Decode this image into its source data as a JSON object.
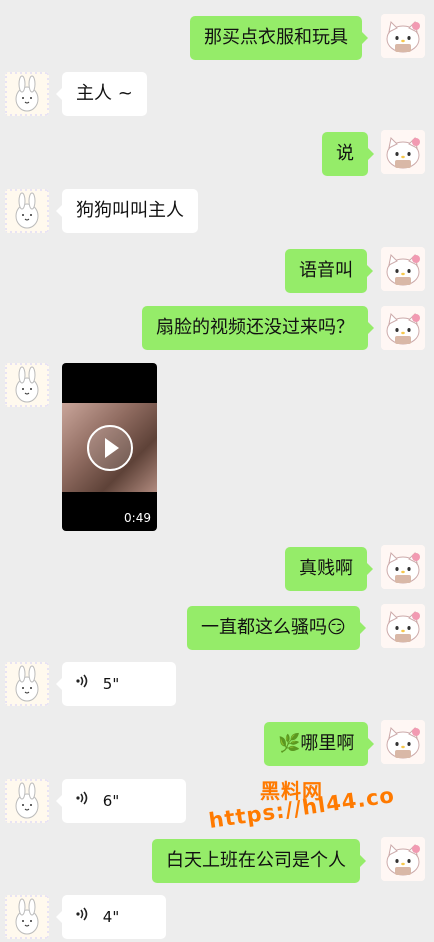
{
  "messages": [
    {
      "side": "right",
      "text": "那买点衣服和玩具"
    },
    {
      "side": "left",
      "text": "主人 ~"
    },
    {
      "side": "right",
      "text": "说"
    },
    {
      "side": "left",
      "text": "狗狗叫叫主人"
    },
    {
      "side": "right",
      "text": "语音叫"
    },
    {
      "side": "right",
      "text": "扇脸的视频还没过来吗？"
    },
    {
      "side": "left",
      "type": "video",
      "duration": "0:49"
    },
    {
      "side": "right",
      "text": "真贱啊"
    },
    {
      "side": "right",
      "text": "一直都这么骚吗😏"
    },
    {
      "side": "left",
      "type": "voice",
      "duration": "5\""
    },
    {
      "side": "right",
      "text": "🌿哪里啊"
    },
    {
      "side": "left",
      "type": "voice",
      "duration": "6\""
    },
    {
      "side": "right",
      "text": "白天上班在公司是个人"
    },
    {
      "side": "left",
      "type": "voice",
      "duration": "4\""
    }
  ],
  "icons": {
    "voice": "voice-wave-icon",
    "play": "play-icon"
  },
  "watermark": {
    "line1": "黑料网",
    "line2": "https://hl44.co"
  }
}
